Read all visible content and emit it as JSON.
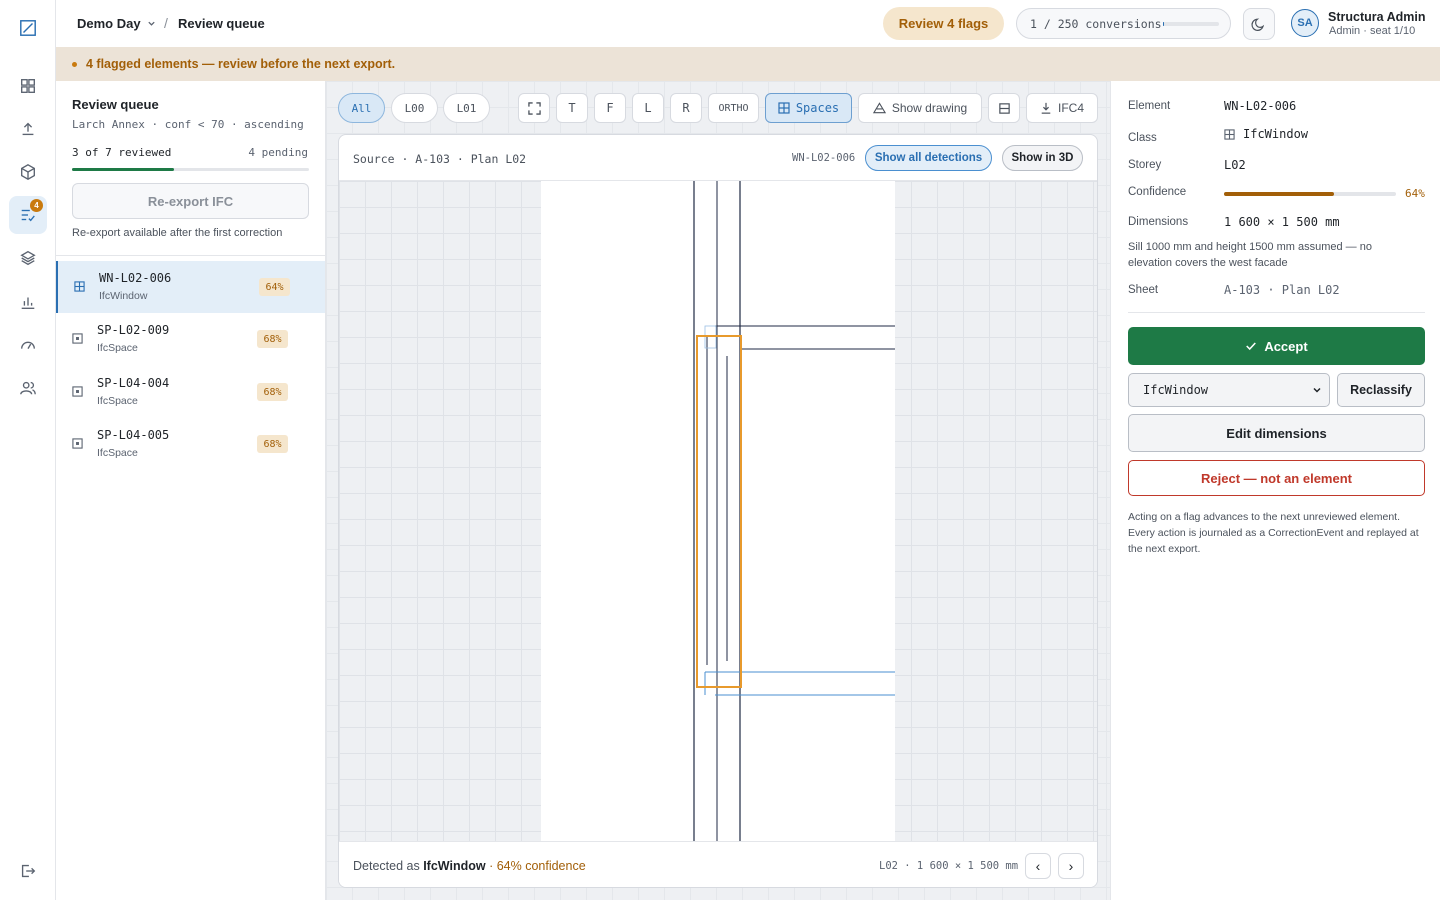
{
  "header": {
    "project": "Demo Day",
    "separator": "/",
    "page": "Review queue",
    "review_flags": "Review 4 flags",
    "conversions": "1 / 250 conversions",
    "conversions_fraction": 0.004,
    "user": {
      "initials": "SA",
      "name": "Structura Admin",
      "role": "Admin · seat 1/10"
    }
  },
  "rail": {
    "review_badge": "4"
  },
  "banner": {
    "text": "4 flagged elements — review before the next export."
  },
  "left": {
    "title": "Review queue",
    "subtitle": "Larch Annex · conf < 70 · ascending",
    "progress_label": "3 of 7 reviewed",
    "progress_fraction": 0.43,
    "pending": "4 pending",
    "reexport_label": "Re-export IFC",
    "reexport_note": "Re-export available after the first correction",
    "items": [
      {
        "id": "WN-L02-006",
        "class": "IfcWindow",
        "conf": "64%",
        "icon": "window-icon",
        "active": true
      },
      {
        "id": "SP-L02-009",
        "class": "IfcSpace",
        "conf": "68%",
        "icon": "space-icon",
        "active": false
      },
      {
        "id": "SP-L04-004",
        "class": "IfcSpace",
        "conf": "68%",
        "icon": "space-icon",
        "active": false
      },
      {
        "id": "SP-L04-005",
        "class": "IfcSpace",
        "conf": "68%",
        "icon": "space-icon",
        "active": false
      }
    ]
  },
  "toolbar": {
    "levels": [
      "All",
      "L00",
      "L01"
    ],
    "views": [
      "T",
      "F",
      "L",
      "R"
    ],
    "ortho": "ORTHO",
    "spaces": "Spaces",
    "show_drawing": "Show drawing",
    "export": "IFC4"
  },
  "card": {
    "source": "Source · A-103 · Plan L02",
    "element_id": "WN-L02-006",
    "show_all": "Show all detections",
    "show_3d": "Show in 3D",
    "footer_prefix": "Detected as",
    "footer_class": "IfcWindow",
    "footer_conf": "· 64% confidence",
    "footer_meta": "L02 · 1 600 × 1 500 mm",
    "prev": "‹",
    "next": "›"
  },
  "right": {
    "element_label": "Element",
    "element_value": "WN-L02-006",
    "class_label": "Class",
    "class_value": "IfcWindow",
    "storey_label": "Storey",
    "storey_value": "L02",
    "confidence_label": "Confidence",
    "confidence_fraction": 0.64,
    "confidence_pct": "64%",
    "dimensions_label": "Dimensions",
    "dimensions_value": "1 600 × 1 500 mm",
    "note": "Sill 1000 mm and height 1500 mm assumed — no elevation covers the west facade",
    "sheet_label": "Sheet",
    "sheet_value": "A-103 · Plan L02",
    "accept": "Accept",
    "class_select": "IfcWindow",
    "reclassify": "Reclassify",
    "edit_dimensions": "Edit dimensions",
    "reject": "Reject — not an element",
    "help": "Acting on a flag advances to the next unreviewed element. Every action is journaled as a CorrectionEvent and replayed at the next export."
  },
  "colors": {
    "accent": "#2a6fb2",
    "flag": "#a25f08",
    "accept": "#1e7a46",
    "reject": "#c0392b",
    "detection_box": "#e89a2c"
  }
}
